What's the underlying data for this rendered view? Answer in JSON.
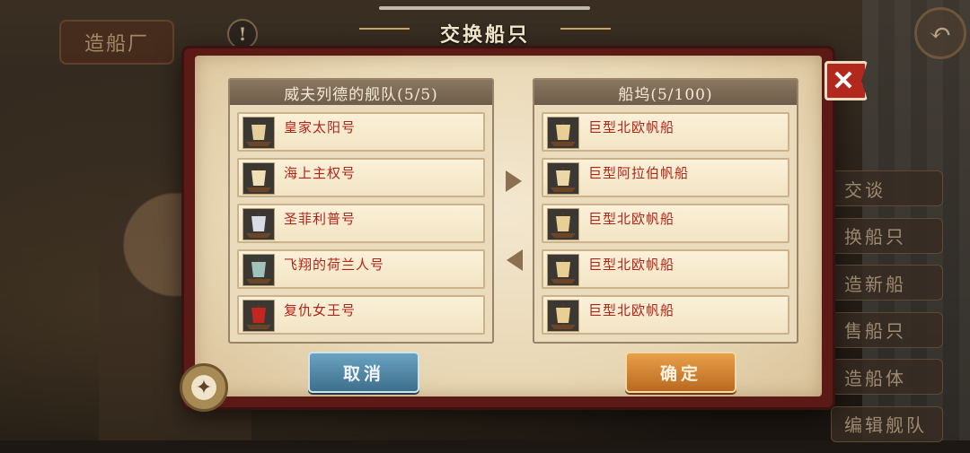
{
  "header": {
    "title": "交换船只"
  },
  "top_left": {
    "home_label": "造船厂",
    "alert_symbol": "!"
  },
  "close_symbol": "✕",
  "back_symbol": "↶",
  "fleet_panel": {
    "header": "威夫列德的舰队(5/5)",
    "ships": [
      {
        "name": "皇家太阳号",
        "icon": "ship-icon",
        "sail_color": "#e6cf9a"
      },
      {
        "name": "海上主权号",
        "icon": "ship-icon",
        "sail_color": "#efe0b8"
      },
      {
        "name": "圣菲利普号",
        "icon": "ship-icon",
        "sail_color": "#d9dbe6"
      },
      {
        "name": "飞翔的荷兰人号",
        "icon": "ship-icon",
        "sail_color": "#9fc3bb"
      },
      {
        "name": "复仇女王号",
        "icon": "ship-icon",
        "sail_color": "#c3261d"
      }
    ]
  },
  "dock_panel": {
    "header": "船坞(5/100)",
    "ships": [
      {
        "name": "巨型北欧帆船",
        "icon": "ship-icon",
        "sail_color": "#e9cf94"
      },
      {
        "name": "巨型阿拉伯帆船",
        "icon": "ship-icon",
        "sail_color": "#ebd8a6"
      },
      {
        "name": "巨型北欧帆船",
        "icon": "ship-icon",
        "sail_color": "#e9cf94"
      },
      {
        "name": "巨型北欧帆船",
        "icon": "ship-icon",
        "sail_color": "#e9cf94"
      },
      {
        "name": "巨型北欧帆船",
        "icon": "ship-icon",
        "sail_color": "#e9cf94"
      }
    ]
  },
  "buttons": {
    "cancel": "取消",
    "confirm": "确定"
  },
  "side_menu": [
    "交谈",
    "换船只",
    "造新船",
    "售船只",
    "造船体",
    "编辑舰队"
  ],
  "colors": {
    "accent_red": "#b0251a",
    "cancel_blue": "#3d6f8c",
    "confirm_orange": "#b9691f"
  }
}
